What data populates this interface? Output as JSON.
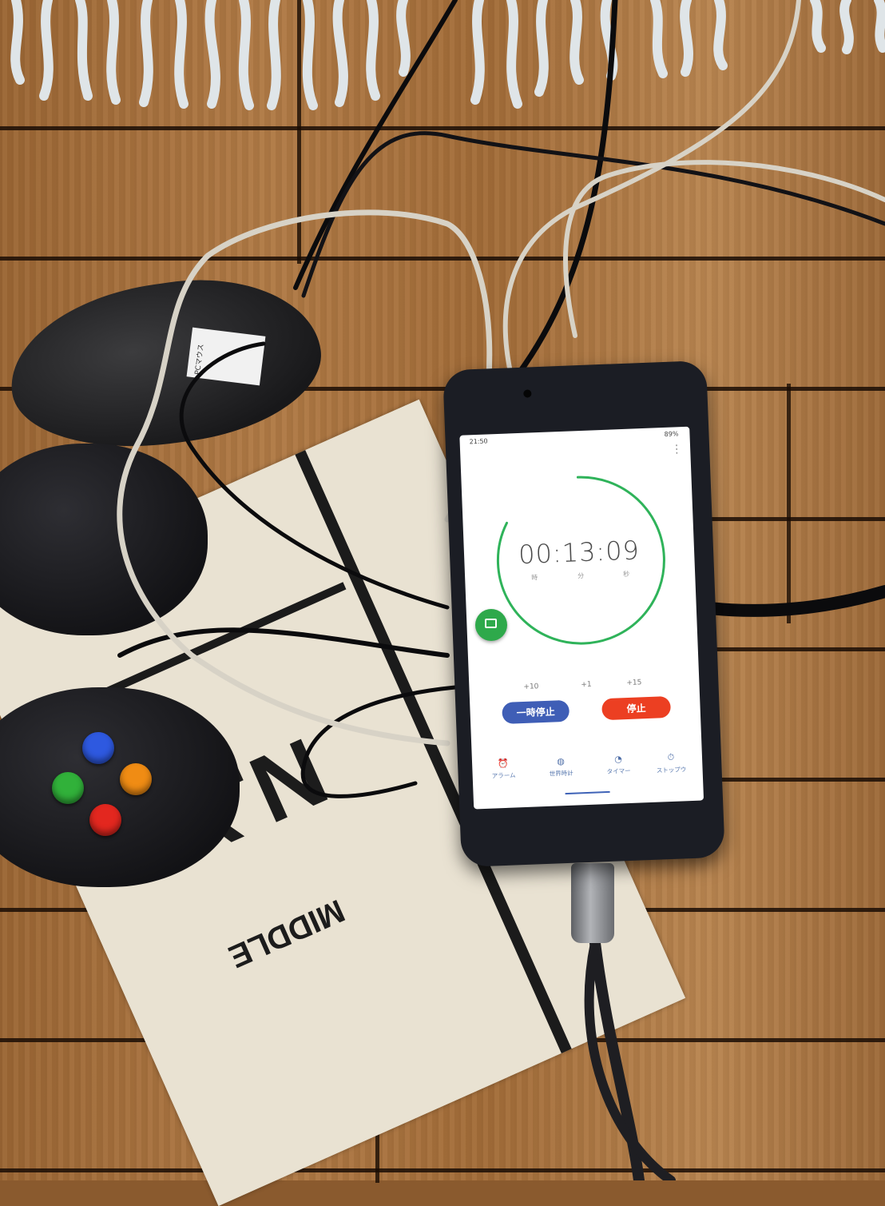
{
  "scene": {
    "mouse_label": "PCマウス",
    "mat_text_large": "N.Y.",
    "mat_text_small": "MIDDLE"
  },
  "phone": {
    "status_bar": {
      "time": "21:50",
      "battery": "89%"
    },
    "timer": {
      "hours": "00",
      "minutes": "13",
      "seconds": "09",
      "separator": ":",
      "unit_hours": "時",
      "unit_minutes": "分",
      "unit_seconds": "秒",
      "ring_progress": 0.83,
      "ring_color": "#2fb35a"
    },
    "add_time": [
      "+10",
      "+1",
      "+15"
    ],
    "buttons": {
      "pause_label": "一時停止",
      "pause_color": "#3f5eb6",
      "stop_label": "停止",
      "stop_color": "#ec3f22"
    },
    "tabs": [
      {
        "label": "アラーム",
        "icon": "alarm-clock-icon"
      },
      {
        "label": "世界時計",
        "icon": "globe-icon"
      },
      {
        "label": "タイマー",
        "icon": "timer-icon"
      },
      {
        "label": "ストップウ",
        "icon": "stopwatch-icon"
      }
    ],
    "active_tab": 1
  }
}
